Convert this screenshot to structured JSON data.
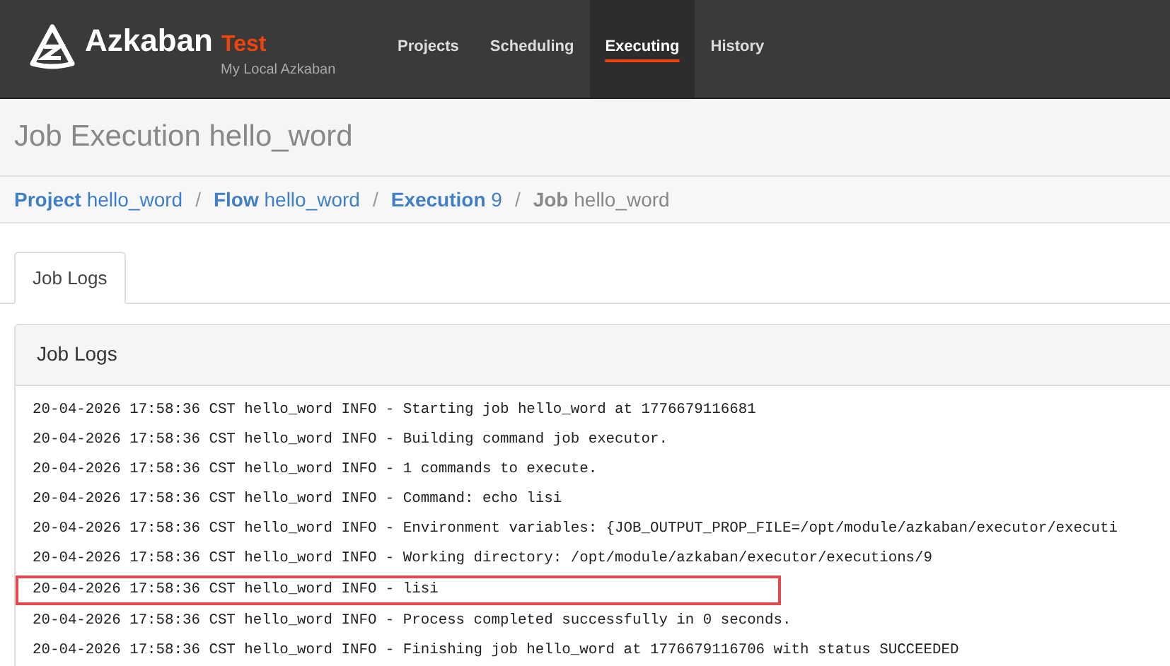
{
  "navbar": {
    "brand": "Azkaban",
    "env": "Test",
    "subtitle": "My Local Azkaban",
    "items": [
      {
        "label": "Projects",
        "selected": false
      },
      {
        "label": "Scheduling",
        "selected": false
      },
      {
        "label": "Executing",
        "selected": true
      },
      {
        "label": "History",
        "selected": false
      }
    ]
  },
  "header": {
    "title": "Job Execution hello_word"
  },
  "breadcrumb": [
    {
      "label": "Project",
      "value": "hello_word",
      "active": false
    },
    {
      "separator": "/",
      "label": "Flow",
      "value": "hello_word",
      "active": false
    },
    {
      "separator": "/",
      "label": "Execution",
      "value": "9",
      "active": false
    },
    {
      "separator": "/",
      "label": "Job",
      "value": "hello_word",
      "active": true
    }
  ],
  "tabs": [
    {
      "label": "Job Logs",
      "selected": true
    }
  ],
  "panel": {
    "title": "Job Logs",
    "lines": [
      {
        "text": "20-04-2026 17:58:36 CST hello_word INFO - Starting job hello_word at 1776679116681",
        "highlighted": false
      },
      {
        "text": "20-04-2026 17:58:36 CST hello_word INFO - Building command job executor.",
        "highlighted": false
      },
      {
        "text": "20-04-2026 17:58:36 CST hello_word INFO - 1 commands to execute.",
        "highlighted": false
      },
      {
        "text": "20-04-2026 17:58:36 CST hello_word INFO - Command: echo lisi",
        "highlighted": false
      },
      {
        "text": "20-04-2026 17:58:36 CST hello_word INFO - Environment variables: {JOB_OUTPUT_PROP_FILE=/opt/module/azkaban/executor/executi",
        "highlighted": false
      },
      {
        "text": "20-04-2026 17:58:36 CST hello_word INFO - Working directory: /opt/module/azkaban/executor/executions/9",
        "highlighted": false
      },
      {
        "text": "20-04-2026 17:58:36 CST hello_word INFO - lisi",
        "highlighted": true
      },
      {
        "text": "20-04-2026 17:58:36 CST hello_word INFO - Process completed successfully in 0 seconds.",
        "highlighted": false
      },
      {
        "text": "20-04-2026 17:58:36 CST hello_word INFO - Finishing job hello_word at 1776679116706 with status SUCCEEDED",
        "highlighted": false
      }
    ]
  }
}
